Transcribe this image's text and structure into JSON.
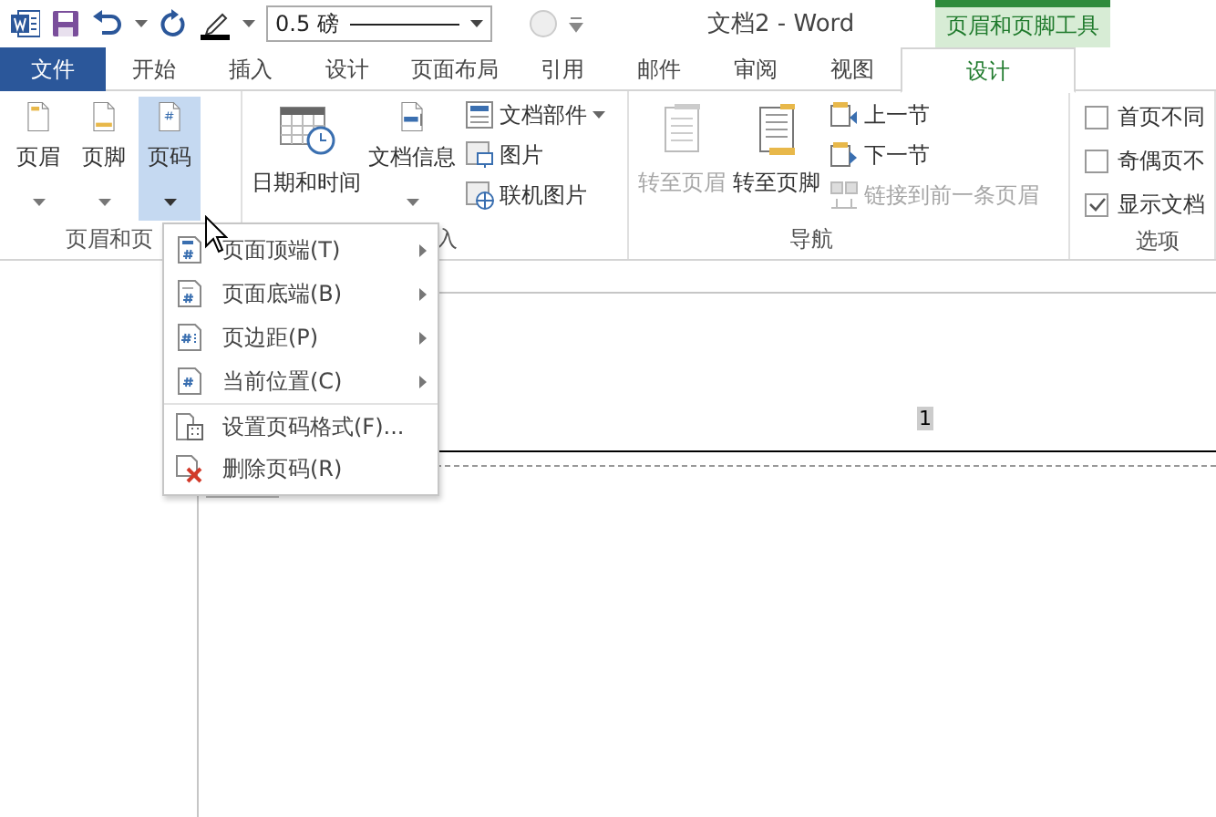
{
  "quick_access": {
    "line_weight": "0.5 磅"
  },
  "window": {
    "title": "文档2 - Word",
    "context_group": "页眉和页脚工具"
  },
  "tabs": [
    {
      "label": "文件",
      "kind": "file",
      "selected": false
    },
    {
      "label": "开始",
      "kind": "normal",
      "selected": false
    },
    {
      "label": "插入",
      "kind": "normal",
      "selected": false
    },
    {
      "label": "设计",
      "kind": "normal",
      "selected": false
    },
    {
      "label": "页面布局",
      "kind": "normal",
      "selected": false
    },
    {
      "label": "引用",
      "kind": "normal",
      "selected": false
    },
    {
      "label": "邮件",
      "kind": "normal",
      "selected": false
    },
    {
      "label": "审阅",
      "kind": "normal",
      "selected": false
    },
    {
      "label": "视图",
      "kind": "normal",
      "selected": false
    },
    {
      "label": "设计",
      "kind": "context",
      "selected": true
    }
  ],
  "ribbon": {
    "groups": [
      {
        "label": "页眉和页",
        "items": [
          {
            "kind": "large",
            "label": "页眉",
            "dropdown": true,
            "pressed": false,
            "disabled": false
          },
          {
            "kind": "large",
            "label": "页脚",
            "dropdown": true,
            "pressed": false,
            "disabled": false
          },
          {
            "kind": "large",
            "label": "页码",
            "dropdown": true,
            "pressed": true,
            "disabled": false
          }
        ]
      },
      {
        "label": "入",
        "items": [
          {
            "kind": "large",
            "label": "日期和时间",
            "dropdown": false,
            "pressed": false,
            "disabled": false
          },
          {
            "kind": "large",
            "label": "文档信息",
            "dropdown": true,
            "pressed": false,
            "disabled": false
          },
          {
            "kind": "small",
            "label": "文档部件",
            "dropdown": true,
            "disabled": false
          },
          {
            "kind": "small",
            "label": "图片",
            "dropdown": false,
            "disabled": false
          },
          {
            "kind": "small",
            "label": "联机图片",
            "dropdown": false,
            "disabled": false
          }
        ]
      },
      {
        "label": "导航",
        "items": [
          {
            "kind": "large",
            "label": "转至页眉",
            "dropdown": false,
            "pressed": false,
            "disabled": true
          },
          {
            "kind": "large",
            "label": "转至页脚",
            "dropdown": false,
            "pressed": false,
            "disabled": false
          },
          {
            "kind": "small",
            "label": "上一节",
            "dropdown": false,
            "disabled": false
          },
          {
            "kind": "small",
            "label": "下一节",
            "dropdown": false,
            "disabled": false
          },
          {
            "kind": "small",
            "label": "链接到前一条页眉",
            "dropdown": false,
            "disabled": true
          }
        ]
      },
      {
        "label": "选项",
        "items": [
          {
            "kind": "check",
            "label": "首页不同",
            "checked": false
          },
          {
            "kind": "check",
            "label": "奇偶页不",
            "checked": false
          },
          {
            "kind": "check",
            "label": "显示文档",
            "checked": true
          }
        ]
      }
    ]
  },
  "menu": {
    "items": [
      {
        "label": "页面顶端(T)",
        "submenu": true,
        "separator_before": false
      },
      {
        "label": "页面底端(B)",
        "submenu": true,
        "separator_before": false
      },
      {
        "label": "页边距(P)",
        "submenu": true,
        "separator_before": false
      },
      {
        "label": "当前位置(C)",
        "submenu": true,
        "separator_before": false
      },
      {
        "label": "设置页码格式(F)...",
        "submenu": false,
        "separator_before": true
      },
      {
        "label": "删除页码(R)",
        "submenu": false,
        "separator_before": false
      }
    ]
  },
  "document": {
    "header_text": "1"
  }
}
